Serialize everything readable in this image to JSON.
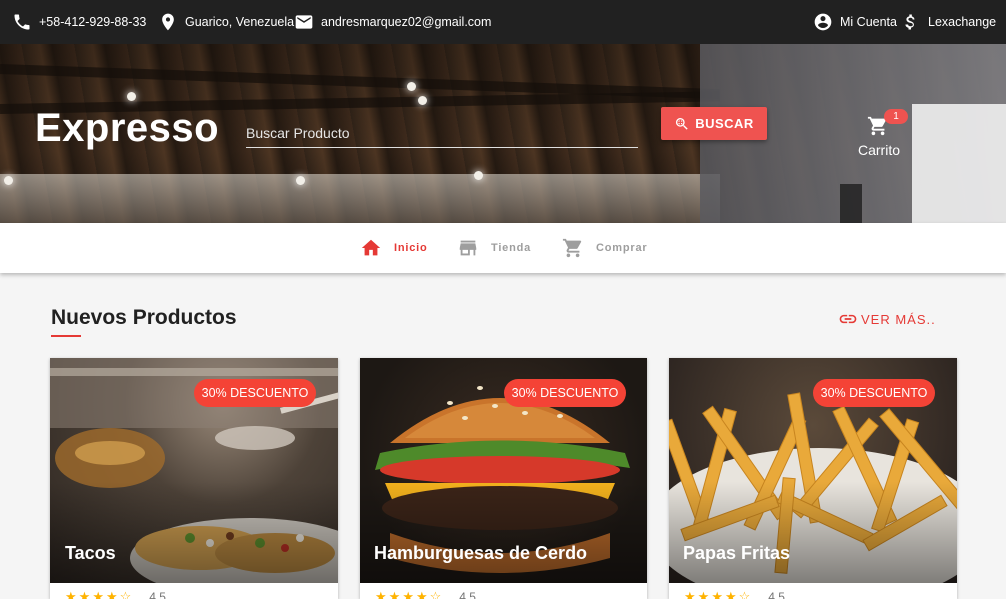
{
  "topbar": {
    "phone": "+58-412-929-88-33",
    "location": "Guarico, Venezuela",
    "email": "andresmarquez02@gmail.com",
    "account": "Mi Cuenta",
    "exchange": "Lexachange"
  },
  "header": {
    "brand": "Expresso",
    "search_placeholder": "Buscar Producto",
    "search_button": "BUSCAR",
    "cart_label": "Carrito",
    "cart_count": "1"
  },
  "nav": {
    "items": [
      {
        "label": "Inicio",
        "icon": "home-icon",
        "active": true
      },
      {
        "label": "Tienda",
        "icon": "store-icon",
        "active": false
      },
      {
        "label": "Comprar",
        "icon": "cart-icon",
        "active": false
      }
    ]
  },
  "section": {
    "title": "Nuevos Productos",
    "more": "VER MÁS.."
  },
  "products": [
    {
      "name": "Tacos",
      "discount": "30%  DESCUENTO",
      "rating": "4.5"
    },
    {
      "name": "Hamburguesas de Cerdo",
      "discount": "30%  DESCUENTO",
      "rating": "4.5"
    },
    {
      "name": "Papas Fritas",
      "discount": "30%  DESCUENTO",
      "rating": "4.5"
    }
  ],
  "colors": {
    "accent": "#e53935",
    "topbar": "#212121",
    "badge": "#f44336",
    "star": "#ffb300"
  }
}
